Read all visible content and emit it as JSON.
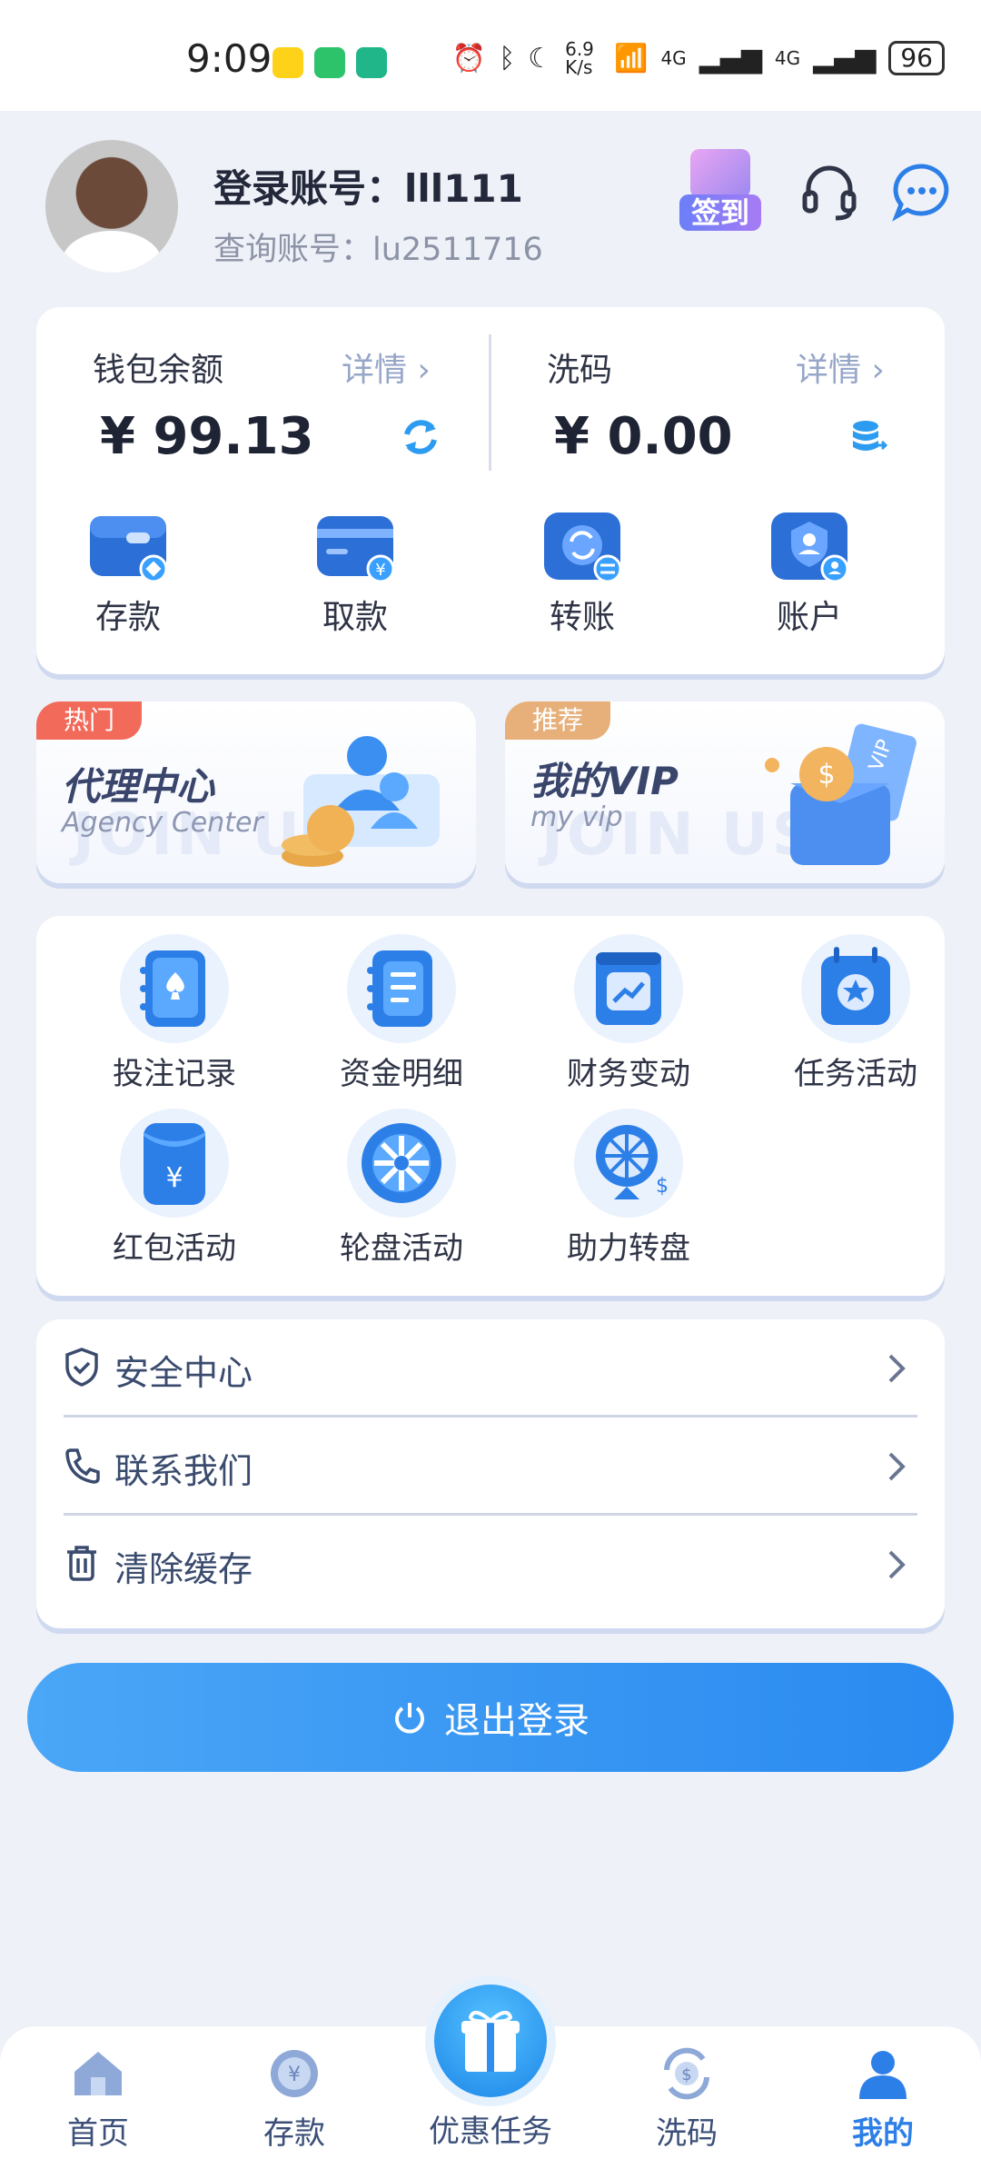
{
  "status_bar": {
    "time": "9:09",
    "net_speed": "6.9 K/s",
    "signal1": "4G",
    "signal2": "4G",
    "battery": "96"
  },
  "profile": {
    "login_account": "登录账号：lll111",
    "query_account": "查询账号：lu2511716",
    "checkin_label": "签到"
  },
  "wallet": {
    "balance_title": "钱包余额",
    "balance_detail": "详情 ›",
    "balance_amount": "¥ 99.13",
    "wash_title": "洗码",
    "wash_detail": "详情 ›",
    "wash_amount": "¥ 0.00",
    "actions": [
      {
        "label": "存款"
      },
      {
        "label": "取款"
      },
      {
        "label": "转账"
      },
      {
        "label": "账户"
      }
    ]
  },
  "promos": [
    {
      "tag": "热门",
      "title": "代理中心",
      "subtitle": "Agency Center",
      "watermark": "JOIN US",
      "tag_color": "#f26a5a"
    },
    {
      "tag": "推荐",
      "title": "我的VIP",
      "subtitle": "my vip",
      "watermark": "JOIN US",
      "tag_color": "#e7b07a"
    }
  ],
  "features": [
    {
      "label": "投注记录",
      "icon": "bet-record-icon"
    },
    {
      "label": "资金明细",
      "icon": "fund-detail-icon"
    },
    {
      "label": "财务变动",
      "icon": "finance-change-icon"
    },
    {
      "label": "任务活动",
      "icon": "task-activity-icon"
    },
    {
      "label": "红包活动",
      "icon": "red-packet-icon"
    },
    {
      "label": "轮盘活动",
      "icon": "roulette-icon"
    },
    {
      "label": "助力转盘",
      "icon": "lucky-wheel-icon"
    }
  ],
  "menu": [
    {
      "label": "安全中心",
      "icon": "shield-icon"
    },
    {
      "label": "联系我们",
      "icon": "phone-icon"
    },
    {
      "label": "清除缓存",
      "icon": "trash-icon"
    }
  ],
  "logout_label": "退出登录",
  "tabs": [
    {
      "label": "首页",
      "icon": "home-icon"
    },
    {
      "label": "存款",
      "icon": "deposit-icon"
    },
    {
      "label": "优惠任务",
      "icon": "gift-icon"
    },
    {
      "label": "洗码",
      "icon": "wash-icon"
    },
    {
      "label": "我的",
      "icon": "user-icon"
    }
  ],
  "colors": {
    "accent": "#2d7fe8",
    "page_bg": "#eef1f7",
    "detail_text": "#96a6c8"
  }
}
